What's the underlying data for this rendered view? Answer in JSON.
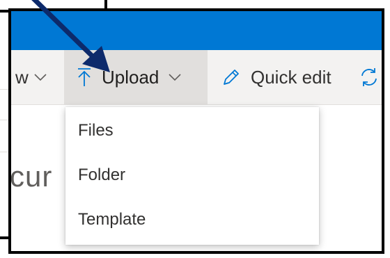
{
  "command_bar": {
    "new_label_partial": "w",
    "upload_label": "Upload",
    "quick_edit_label": "Quick edit"
  },
  "upload_menu": {
    "items": [
      {
        "label": "Files"
      },
      {
        "label": "Folder"
      },
      {
        "label": "Template"
      }
    ]
  },
  "page": {
    "title_partial": "cur"
  },
  "colors": {
    "suite_bar": "#0078d4",
    "command_bar": "#f3f2f1",
    "upload_active": "#e1dfdd",
    "icon_blue": "#0078d4",
    "arrow": "#0d2a6b"
  }
}
